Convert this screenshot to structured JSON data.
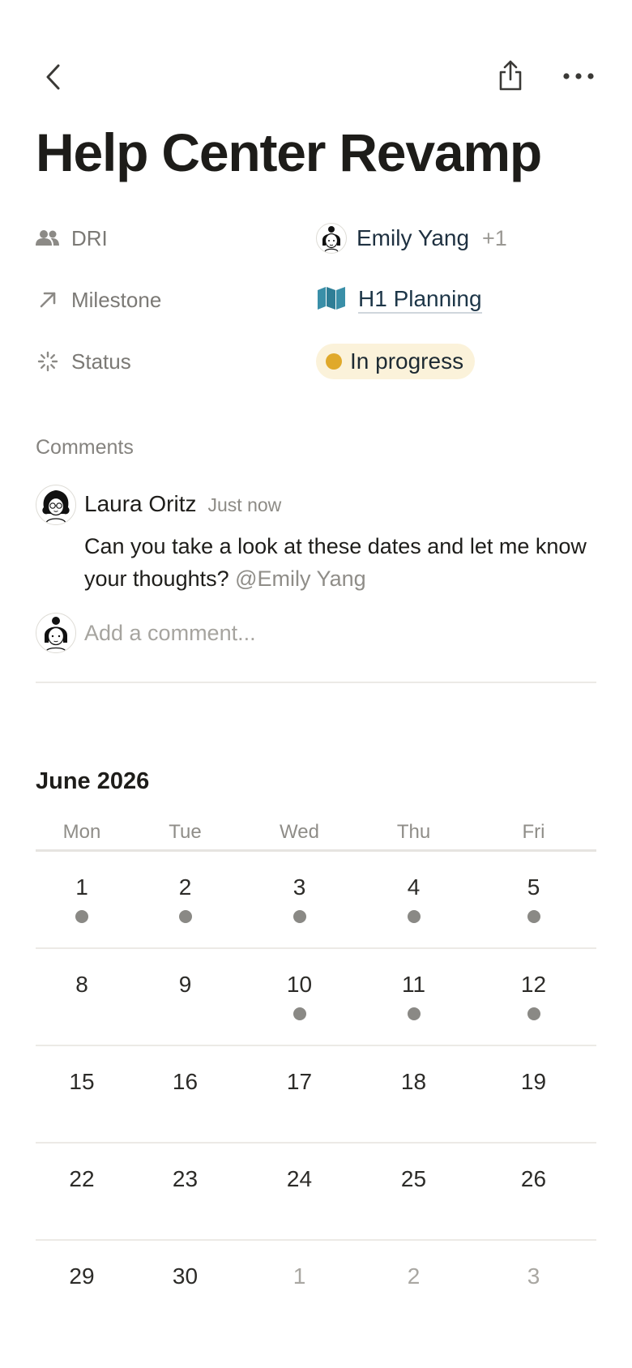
{
  "page": {
    "title": "Help Center Revamp"
  },
  "toolbar": {
    "back_icon": "chevron-left-icon",
    "share_icon": "share-icon",
    "more_icon": "more-horizontal-icon"
  },
  "properties": {
    "dri": {
      "label": "DRI",
      "icon": "people-icon",
      "person": "Emily Yang",
      "extra": "+1"
    },
    "milestone": {
      "label": "Milestone",
      "icon": "arrow-up-right-icon",
      "value": "H1 Planning",
      "value_icon": "map-icon"
    },
    "status": {
      "label": "Status",
      "icon": "loading-spinner-icon",
      "value": "In progress",
      "color": "#e0a92b"
    }
  },
  "comments": {
    "section_label": "Comments",
    "items": [
      {
        "author": "Laura Oritz",
        "time": "Just now",
        "text": "Can you take a look at these dates and let me know your thoughts? ",
        "mention": "@Emily Yang"
      }
    ],
    "input_placeholder": "Add a comment..."
  },
  "calendar": {
    "month": "June 2026",
    "weekdays": [
      "Mon",
      "Tue",
      "Wed",
      "Thu",
      "Fri"
    ],
    "weeks": [
      [
        {
          "d": "1",
          "dot": true
        },
        {
          "d": "2",
          "dot": true
        },
        {
          "d": "3",
          "dot": true
        },
        {
          "d": "4",
          "dot": true
        },
        {
          "d": "5",
          "dot": true
        }
      ],
      [
        {
          "d": "8",
          "dot": false
        },
        {
          "d": "9",
          "dot": false
        },
        {
          "d": "10",
          "dot": true
        },
        {
          "d": "11",
          "dot": true
        },
        {
          "d": "12",
          "dot": true
        }
      ],
      [
        {
          "d": "15",
          "dot": false
        },
        {
          "d": "16",
          "dot": false
        },
        {
          "d": "17",
          "dot": false
        },
        {
          "d": "18",
          "dot": false
        },
        {
          "d": "19",
          "dot": false
        }
      ],
      [
        {
          "d": "22",
          "dot": false
        },
        {
          "d": "23",
          "dot": false
        },
        {
          "d": "24",
          "dot": false
        },
        {
          "d": "25",
          "dot": false
        },
        {
          "d": "26",
          "dot": false
        }
      ],
      [
        {
          "d": "29",
          "dot": false
        },
        {
          "d": "30",
          "dot": false
        },
        {
          "d": "1",
          "dot": false,
          "muted": true
        },
        {
          "d": "2",
          "dot": false,
          "muted": true
        },
        {
          "d": "3",
          "dot": false,
          "muted": true
        }
      ]
    ]
  }
}
